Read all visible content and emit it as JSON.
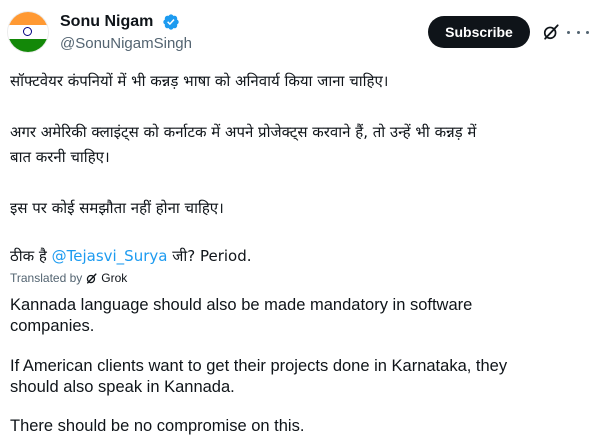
{
  "author": {
    "name": "Sonu Nigam",
    "handle": "@SonuNigamSingh",
    "verified": true
  },
  "actions": {
    "subscribe_label": "Subscribe"
  },
  "icons": {
    "grok": "grok-icon",
    "more": "more-options-icon",
    "verified": "verified-badge-icon"
  },
  "colors": {
    "mention": "#1d9bf0",
    "verified": "#1d9bf0",
    "secondary_text": "#536471"
  },
  "post": {
    "lines": [
      "सॉफ्टवेयर कंपनियों में भी कन्नड़ भाषा को अनिवार्य किया जाना चाहिए।",
      "अगर अमेरिकी क्लाइंट्स को कर्नाटक में अपने प्रोजेक्ट्स करवाने हैं, तो उन्हें भी कन्नड़ में",
      "बात करनी चाहिए।",
      "इस पर कोई समझौता नहीं होना चाहिए।"
    ],
    "last_line_prefix": "ठीक है ",
    "mention": "@Tejasvi_Surya",
    "last_line_suffix": " जी? Period."
  },
  "translation": {
    "label": "Translated by",
    "provider": "Grok",
    "lines": [
      "Kannada language should also be made mandatory in software",
      "companies.",
      "If American clients want to get their projects done in Karnataka, they",
      "should also speak in Kannada.",
      "There should be no compromise on this."
    ]
  }
}
